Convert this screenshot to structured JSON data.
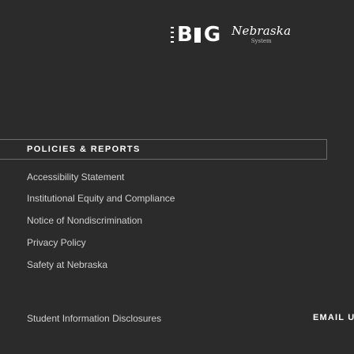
{
  "header": {
    "big_logo": "BIG",
    "nebraska_logo": {
      "wordmark": "Nebraska",
      "subtitle": "System"
    }
  },
  "policies": {
    "heading": "POLICIES & REPORTS",
    "links": [
      "Accessibility Statement",
      "Institutional Equity and Compliance",
      "Notice of Nondiscrimination",
      "Privacy Policy",
      "Safety at Nebraska"
    ]
  },
  "footer": {
    "student_link": "Student Information Disclosures",
    "email_label": "EMAIL U"
  },
  "colors": {
    "background": "#2b2b2b",
    "border": "#6d6d6d",
    "link_text": "#d0d0d0",
    "heading_text": "#ffffff"
  }
}
